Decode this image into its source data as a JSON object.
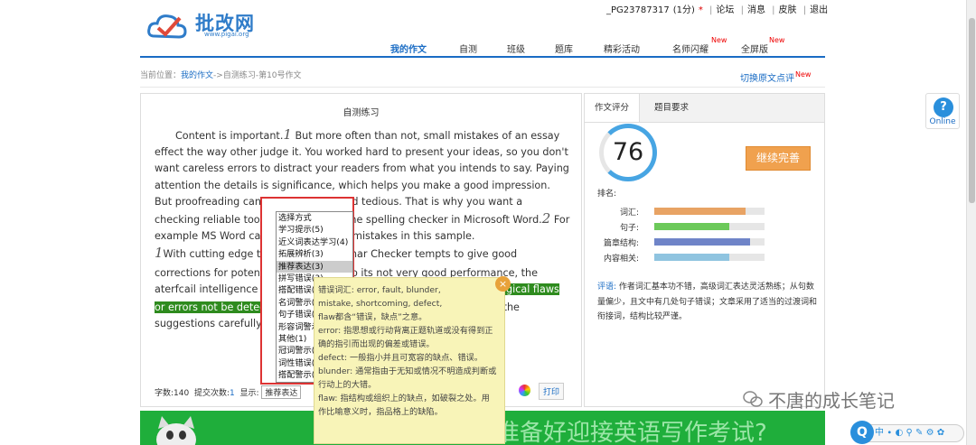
{
  "header": {
    "logo_text": "批改网",
    "logo_url": "www.pigai.org",
    "user_id": "_PG23787317",
    "user_count": "(1分)",
    "user_star": "*",
    "links": [
      "论坛",
      "消息",
      "皮肤",
      "退出"
    ]
  },
  "nav": {
    "items": [
      {
        "label": "我的作文",
        "active": true
      },
      {
        "label": "自测"
      },
      {
        "label": "班级"
      },
      {
        "label": "题库"
      },
      {
        "label": "精彩活动"
      },
      {
        "label": "名师闪耀",
        "new": "New"
      },
      {
        "label": "全屏版",
        "new": "New"
      }
    ]
  },
  "breadcrumb": {
    "prefix": "当前位置：",
    "link": "我的作文",
    "rest": "->自测练习-第10号作文"
  },
  "switch_link": {
    "label": "切换原文点评",
    "new": "New"
  },
  "essay": {
    "panel_title": "自测练习",
    "seg1": "Content is important.",
    "n1": "1",
    "seg2": " But more often than not, small mistakes of an essay effect the way other judge it. You worked hard to present your ideas, so you don't want careless errors to distract your readers from what you intends to say. Paying attention the details is significance, which helps you make a good impression. But proofreading can be exhausting and tedious. That is why you want a checking reliable tool.",
    "n2": "1",
    "seg3": " Don't rely on the spelling checker in Microsoft Word.",
    "n3": "2",
    "seg4": " For example MS Word cannot catch all the mistakes in this sample.",
    "n4": "1",
    "seg5": "With cutting edge technology, Grammar Checker tempts to give good corrections for potential errors.",
    "n5": "1",
    "seg6": " Due to its not very good performance, the aterfcail intelligence is still not 100 percent accurate. ",
    "hl1": "For example, logical flaws or errors ",
    "hl2": "not be detected.",
    "n6": "2",
    "seg7": " Therefore, it's essential that you choose the suggestions carefully."
  },
  "footer": {
    "word_count_label": "字数:",
    "word_count": "140",
    "submit_label": "提交次数:",
    "submit_count": "1",
    "show_label": "显示:",
    "show_value": "推荐表达",
    "print_label": "打印"
  },
  "dropdown": {
    "options": [
      "选择方式",
      "学习提示(5)",
      "近义词表达学习(4)",
      "拓展辨析(3)",
      "推荐表达(3)",
      "拼写错误(3)",
      "搭配错误(2)",
      "名词警示(2)",
      "句子错误(2)",
      "形容词警示(2)",
      "其他(1)",
      "冠词警示(1)",
      "词性错误(1)",
      "搭配警示(1)"
    ],
    "selected_index": 4
  },
  "tooltip": {
    "lines": [
      "错误词汇: error, fault, blunder,",
      "mistake, shortcoming, defect,",
      "flaw都含“错误，缺点”之意。",
      "error: 指思想或行动背离正题轨道或没有得到正",
      "确的指引而出现的偏差或错误。",
      "defect: 一般指小并且可宽容的缺点、错误。",
      "blunder: 通常指由于无知或情况不明造成判断或",
      "行动上的大错。",
      "flaw: 指结构或组织上的缺点，如破裂之处。用",
      "作比喻意义时，指品格上的缺陷。"
    ]
  },
  "right": {
    "tabs": [
      "作文评分",
      "题目要求"
    ],
    "score": "76",
    "continue_label": "继续完善",
    "rank_label": "排名:",
    "bars": [
      {
        "label": "词汇:",
        "value": 0.83,
        "color": "#e8a364"
      },
      {
        "label": "句子:",
        "value": 0.68,
        "color": "#6cc95a"
      },
      {
        "label": "篇章结构:",
        "value": 0.87,
        "color": "#6f84c8"
      },
      {
        "label": "内容相关:",
        "value": 0.68,
        "color": "#8fc4e0"
      }
    ],
    "comment_label": "评语:",
    "comment": "作者词汇基本功不错，高级词汇表达灵活熟练；从句数量偏少，且文中有几处句子错误；文章采用了适当的过渡词和衔接词，结构比较严谨。"
  },
  "online": {
    "label": "Online"
  },
  "banner": {
    "text": "你是否已准备好迎接英语写作考试?"
  },
  "watermark": {
    "text": "不唐的成长笔记"
  },
  "ime": {
    "text": "中 ∙ ◐ ⚲ ✎ ⚙ ✿"
  }
}
